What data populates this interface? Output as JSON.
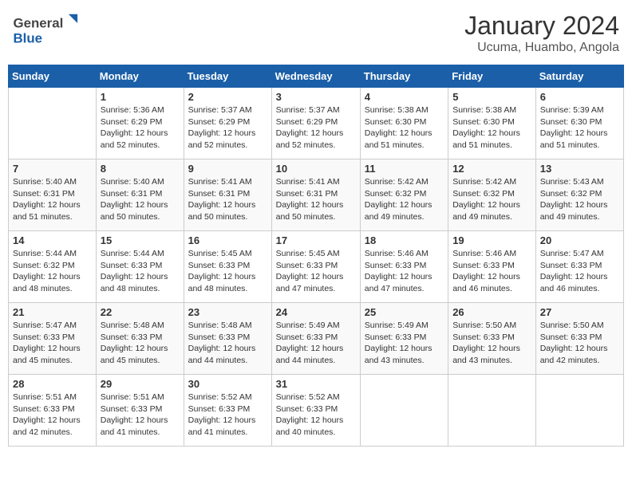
{
  "header": {
    "logo_general": "General",
    "logo_blue": "Blue",
    "month_title": "January 2024",
    "subtitle": "Ucuma, Huambo, Angola"
  },
  "calendar": {
    "days_of_week": [
      "Sunday",
      "Monday",
      "Tuesday",
      "Wednesday",
      "Thursday",
      "Friday",
      "Saturday"
    ],
    "weeks": [
      [
        {
          "day": "",
          "info": ""
        },
        {
          "day": "1",
          "info": "Sunrise: 5:36 AM\nSunset: 6:29 PM\nDaylight: 12 hours\nand 52 minutes."
        },
        {
          "day": "2",
          "info": "Sunrise: 5:37 AM\nSunset: 6:29 PM\nDaylight: 12 hours\nand 52 minutes."
        },
        {
          "day": "3",
          "info": "Sunrise: 5:37 AM\nSunset: 6:29 PM\nDaylight: 12 hours\nand 52 minutes."
        },
        {
          "day": "4",
          "info": "Sunrise: 5:38 AM\nSunset: 6:30 PM\nDaylight: 12 hours\nand 51 minutes."
        },
        {
          "day": "5",
          "info": "Sunrise: 5:38 AM\nSunset: 6:30 PM\nDaylight: 12 hours\nand 51 minutes."
        },
        {
          "day": "6",
          "info": "Sunrise: 5:39 AM\nSunset: 6:30 PM\nDaylight: 12 hours\nand 51 minutes."
        }
      ],
      [
        {
          "day": "7",
          "info": "Sunrise: 5:40 AM\nSunset: 6:31 PM\nDaylight: 12 hours\nand 51 minutes."
        },
        {
          "day": "8",
          "info": "Sunrise: 5:40 AM\nSunset: 6:31 PM\nDaylight: 12 hours\nand 50 minutes."
        },
        {
          "day": "9",
          "info": "Sunrise: 5:41 AM\nSunset: 6:31 PM\nDaylight: 12 hours\nand 50 minutes."
        },
        {
          "day": "10",
          "info": "Sunrise: 5:41 AM\nSunset: 6:31 PM\nDaylight: 12 hours\nand 50 minutes."
        },
        {
          "day": "11",
          "info": "Sunrise: 5:42 AM\nSunset: 6:32 PM\nDaylight: 12 hours\nand 49 minutes."
        },
        {
          "day": "12",
          "info": "Sunrise: 5:42 AM\nSunset: 6:32 PM\nDaylight: 12 hours\nand 49 minutes."
        },
        {
          "day": "13",
          "info": "Sunrise: 5:43 AM\nSunset: 6:32 PM\nDaylight: 12 hours\nand 49 minutes."
        }
      ],
      [
        {
          "day": "14",
          "info": "Sunrise: 5:44 AM\nSunset: 6:32 PM\nDaylight: 12 hours\nand 48 minutes."
        },
        {
          "day": "15",
          "info": "Sunrise: 5:44 AM\nSunset: 6:33 PM\nDaylight: 12 hours\nand 48 minutes."
        },
        {
          "day": "16",
          "info": "Sunrise: 5:45 AM\nSunset: 6:33 PM\nDaylight: 12 hours\nand 48 minutes."
        },
        {
          "day": "17",
          "info": "Sunrise: 5:45 AM\nSunset: 6:33 PM\nDaylight: 12 hours\nand 47 minutes."
        },
        {
          "day": "18",
          "info": "Sunrise: 5:46 AM\nSunset: 6:33 PM\nDaylight: 12 hours\nand 47 minutes."
        },
        {
          "day": "19",
          "info": "Sunrise: 5:46 AM\nSunset: 6:33 PM\nDaylight: 12 hours\nand 46 minutes."
        },
        {
          "day": "20",
          "info": "Sunrise: 5:47 AM\nSunset: 6:33 PM\nDaylight: 12 hours\nand 46 minutes."
        }
      ],
      [
        {
          "day": "21",
          "info": "Sunrise: 5:47 AM\nSunset: 6:33 PM\nDaylight: 12 hours\nand 45 minutes."
        },
        {
          "day": "22",
          "info": "Sunrise: 5:48 AM\nSunset: 6:33 PM\nDaylight: 12 hours\nand 45 minutes."
        },
        {
          "day": "23",
          "info": "Sunrise: 5:48 AM\nSunset: 6:33 PM\nDaylight: 12 hours\nand 44 minutes."
        },
        {
          "day": "24",
          "info": "Sunrise: 5:49 AM\nSunset: 6:33 PM\nDaylight: 12 hours\nand 44 minutes."
        },
        {
          "day": "25",
          "info": "Sunrise: 5:49 AM\nSunset: 6:33 PM\nDaylight: 12 hours\nand 43 minutes."
        },
        {
          "day": "26",
          "info": "Sunrise: 5:50 AM\nSunset: 6:33 PM\nDaylight: 12 hours\nand 43 minutes."
        },
        {
          "day": "27",
          "info": "Sunrise: 5:50 AM\nSunset: 6:33 PM\nDaylight: 12 hours\nand 42 minutes."
        }
      ],
      [
        {
          "day": "28",
          "info": "Sunrise: 5:51 AM\nSunset: 6:33 PM\nDaylight: 12 hours\nand 42 minutes."
        },
        {
          "day": "29",
          "info": "Sunrise: 5:51 AM\nSunset: 6:33 PM\nDaylight: 12 hours\nand 41 minutes."
        },
        {
          "day": "30",
          "info": "Sunrise: 5:52 AM\nSunset: 6:33 PM\nDaylight: 12 hours\nand 41 minutes."
        },
        {
          "day": "31",
          "info": "Sunrise: 5:52 AM\nSunset: 6:33 PM\nDaylight: 12 hours\nand 40 minutes."
        },
        {
          "day": "",
          "info": ""
        },
        {
          "day": "",
          "info": ""
        },
        {
          "day": "",
          "info": ""
        }
      ]
    ]
  }
}
